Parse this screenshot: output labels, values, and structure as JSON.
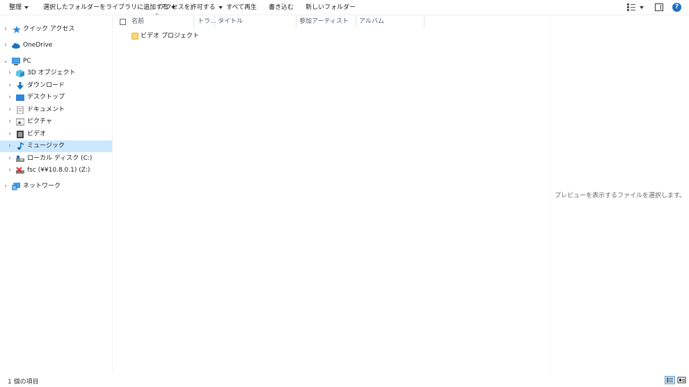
{
  "toolbar": {
    "organize": "整理",
    "add_to_library": "選択したフォルダーをライブラリに追加する",
    "give_access": "アクセスを許可する",
    "play_all": "すべて再生",
    "burn": "書き込む",
    "new_folder": "新しいフォルダー"
  },
  "nav": {
    "quick_access": "クイック アクセス",
    "onedrive": "OneDrive",
    "pc": "PC",
    "objects_3d": "3D オブジェクト",
    "downloads": "ダウンロード",
    "desktop": "デスクトップ",
    "documents": "ドキュメント",
    "pictures": "ピクチャ",
    "videos": "ビデオ",
    "music": "ミュージック",
    "local_disk": "ローカル ディスク (C:)",
    "network_drive": "fsc (¥¥10.8.0.1) (Z:)",
    "network": "ネットワーク"
  },
  "columns": {
    "name": "名前",
    "track": "トラ...",
    "title": "タイトル",
    "contributing_artists": "参加アーティスト",
    "album": "アルバム"
  },
  "files": [
    {
      "name": "ビデオ プロジェクト"
    }
  ],
  "preview": {
    "empty_message": "プレビューを表示するファイルを選択します。"
  },
  "status": {
    "item_count": "1 個の項目"
  },
  "colors": {
    "selection": "#cce8ff",
    "folder": "#f8d876",
    "help": "#1f6fc6"
  }
}
